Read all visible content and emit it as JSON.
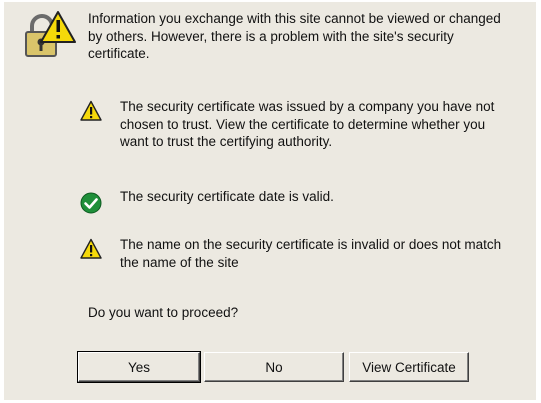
{
  "header": {
    "message": "Information you exchange with this site cannot be viewed or changed by others. However, there is a problem with the site's security certificate."
  },
  "items": [
    {
      "icon": "warning-icon",
      "status": "warning",
      "text": "The security certificate was issued by a company you have not chosen to trust. View the certificate to determine whether you want to trust the certifying authority."
    },
    {
      "icon": "check-icon",
      "status": "ok",
      "text": "The security certificate date is valid."
    },
    {
      "icon": "warning-icon",
      "status": "warning",
      "text": "The name on the security certificate is invalid or does not match the name of the site"
    }
  ],
  "question": "Do you want to proceed?",
  "buttons": {
    "yes": "Yes",
    "no": "No",
    "view_certificate": "View Certificate"
  },
  "colors": {
    "dialog_background": "#ece9e1",
    "warning_yellow": "#f5d90a",
    "ok_green": "#1f8f3a"
  }
}
